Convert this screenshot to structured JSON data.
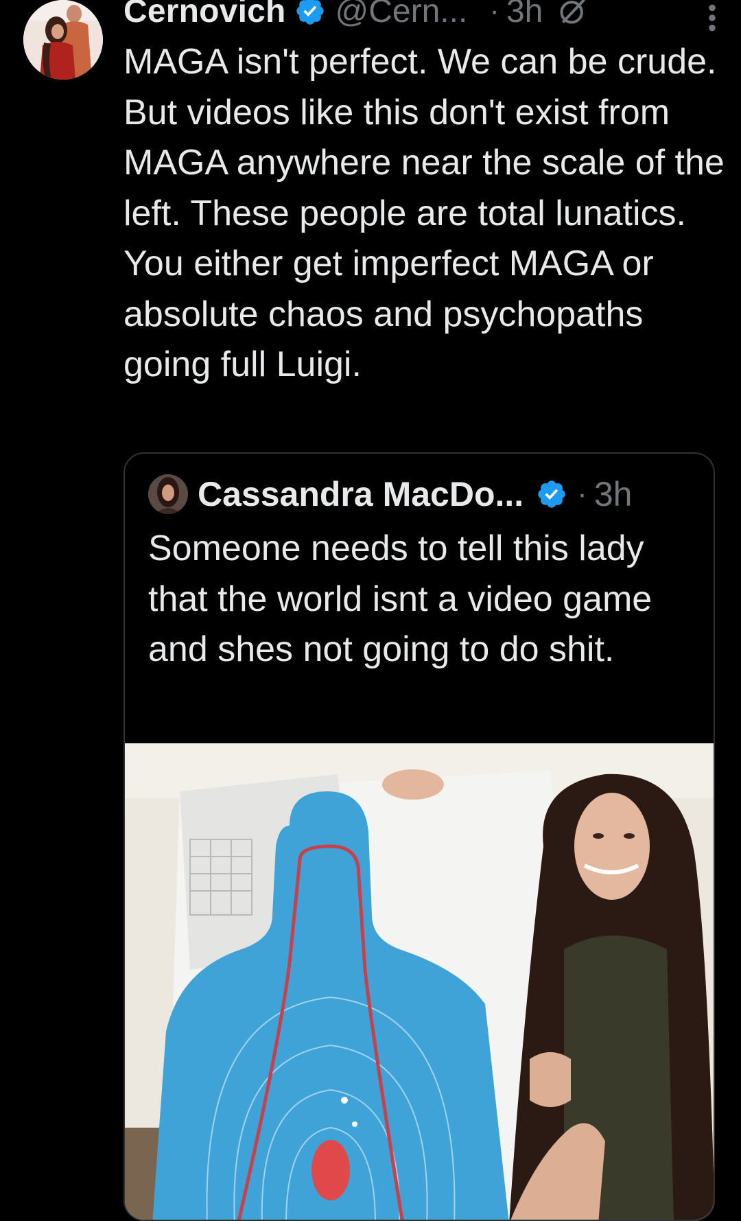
{
  "tweet": {
    "display_name": "Cernovich",
    "handle": "@Cern...",
    "separator": "·",
    "time": "3h",
    "text": "MAGA isn't perfect. We can be crude. But videos like this don't exist from MAGA anywhere near the scale of the left. These people are total lunatics. You either get imperfect MAGA or absolute chaos and psychopaths going full Luigi.",
    "icons": {
      "avatar": "user-avatar",
      "verified": "verified-badge-icon",
      "grok": "grok-icon",
      "more": "more-vertical-icon"
    }
  },
  "quoted_tweet": {
    "display_name": "Cassandra MacDo...",
    "separator": "·",
    "time": "3h",
    "text": "Someone needs to tell this lady that the world isnt a video game and shes not going to do shit.",
    "media": "video-thumbnail"
  },
  "colors": {
    "background": "#000000",
    "text_primary": "#e7e9ea",
    "text_secondary": "#71767b",
    "verified_blue": "#1d9bf0",
    "card_border": "#2f3336",
    "target_blue": "#3fa3d8",
    "target_red": "#e0484a"
  }
}
